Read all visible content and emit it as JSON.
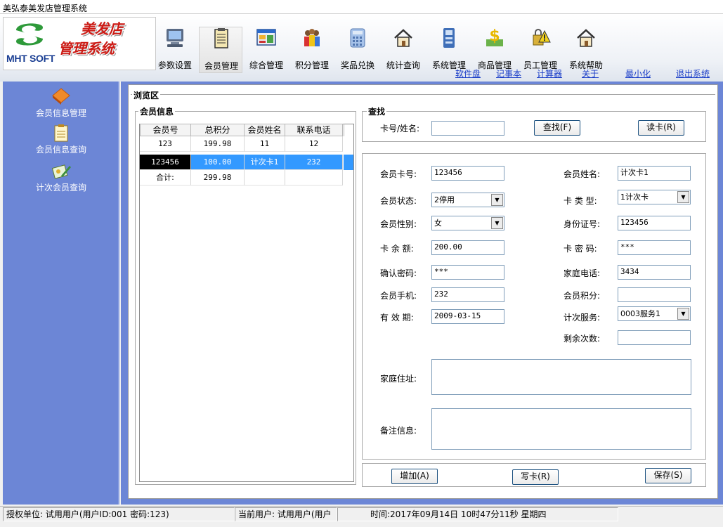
{
  "window": {
    "title": "美弘泰美发店管理系统"
  },
  "logo": {
    "brand": "MHT SOFT",
    "line1": "美发店",
    "line2": "管理系统"
  },
  "toolbar": {
    "items": [
      {
        "label": "参数设置",
        "icon": "computer-icon"
      },
      {
        "label": "会员管理",
        "icon": "member-card-icon"
      },
      {
        "label": "综合管理",
        "icon": "window-icon"
      },
      {
        "label": "积分管理",
        "icon": "people-icon"
      },
      {
        "label": "奖品兑换",
        "icon": "calculator-icon"
      },
      {
        "label": "统计查询",
        "icon": "house-icon"
      },
      {
        "label": "系统管理",
        "icon": "settings-icon"
      },
      {
        "label": "商品管理",
        "icon": "dollar-icon"
      },
      {
        "label": "员工管理",
        "icon": "warning-lock-icon"
      },
      {
        "label": "系统帮助",
        "icon": "help-house-icon"
      }
    ]
  },
  "links": [
    "软件盘",
    "记事本",
    "计算器",
    "关于",
    "最小化",
    "退出系统"
  ],
  "sidebar": {
    "items": [
      {
        "label": "会员信息管理",
        "icon": "diamond-icon"
      },
      {
        "label": "会员信息查询",
        "icon": "clipboard-icon"
      },
      {
        "label": "计次会员查询",
        "icon": "card-pen-icon"
      }
    ]
  },
  "browse": {
    "title": "浏览区"
  },
  "member_info": {
    "title": "会员信息",
    "columns": [
      "会员号",
      "总积分",
      "会员姓名",
      "联系电话"
    ],
    "rows": [
      [
        "123",
        "199.98",
        "11",
        "12"
      ],
      [
        "123456",
        "100.00",
        "计次卡1",
        "232"
      ]
    ],
    "total_label": "合计:",
    "total_value": "299.98"
  },
  "search": {
    "title": "查找",
    "label": "卡号/姓名:",
    "value": "",
    "search_button": "查找(F)",
    "read_card_button": "读卡(R)"
  },
  "form": {
    "card_no": {
      "label": "会员卡号:",
      "value": "123456"
    },
    "name": {
      "label": "会员姓名:",
      "value": "计次卡1"
    },
    "status": {
      "label": "会员状态:",
      "value": "2停用"
    },
    "card_type": {
      "label": "卡 类 型:",
      "value": "1计次卡"
    },
    "gender": {
      "label": "会员性别:",
      "value": "女"
    },
    "id_no": {
      "label": "身份证号:",
      "value": "123456"
    },
    "balance": {
      "label": "卡 余 额:",
      "value": "200.00"
    },
    "password": {
      "label": "卡 密 码:",
      "value": "***"
    },
    "confirm": {
      "label": "确认密码:",
      "value": "***"
    },
    "home_phone": {
      "label": "家庭电话:",
      "value": "3434"
    },
    "mobile": {
      "label": "会员手机:",
      "value": "232"
    },
    "points": {
      "label": "会员积分:",
      "value": ""
    },
    "expiry": {
      "label": "有 效 期:",
      "value": "2009-03-15"
    },
    "service": {
      "label": "计次服务:",
      "value": "0003服务1"
    },
    "remaining": {
      "label": "剩余次数:",
      "value": ""
    },
    "address": {
      "label": "家庭住址:",
      "value": ""
    },
    "remarks": {
      "label": "备注信息:",
      "value": ""
    }
  },
  "actions": {
    "add": "增加(A)",
    "write_card": "写卡(R)",
    "save": "保存(S)"
  },
  "status": {
    "org": "授权单位: 试用用户(用户ID:001 密码:123)",
    "user": "当前用户: 试用用户(用户",
    "time": "时间:2017年09月14日 10时47分11秒 星期四"
  },
  "colors": {
    "sidebar_bg": "#6c86d6",
    "selected_row": "#3399ff",
    "link": "#1a3dc8",
    "logo_red": "#cc1a14"
  }
}
